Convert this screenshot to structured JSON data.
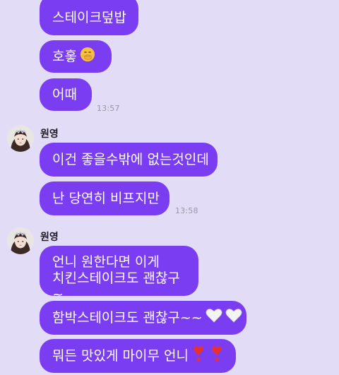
{
  "conversation": {
    "block1": {
      "messages": [
        {
          "text": "스테이크덮밥"
        },
        {
          "text": "호홓"
        },
        {
          "text": "어때"
        }
      ],
      "time": "13:57"
    },
    "block2": {
      "sender": "원영",
      "messages": [
        {
          "text": "이건 좋을수밖에 없는것인데"
        },
        {
          "text": "난 당연히 비프지만"
        }
      ],
      "time": "13:58"
    },
    "block3": {
      "sender": "원영",
      "messages": [
        {
          "line1": "언니 원한다면 이게",
          "line2": "치킨스테이크도 괜찮구~"
        },
        {
          "text": "함박스테이크도 괜찮구~~"
        },
        {
          "text": "뭐든 맛있게 마이무 언니"
        }
      ]
    }
  },
  "colors": {
    "background": "#e3dcf7",
    "bubble": "#7b3df2",
    "bubble_text": "#ffffff",
    "timestamp": "#9a95a8"
  },
  "icons": {
    "hoho_emoji": "face-with-hand-over-mouth-emoji",
    "hearts": "white-heart-emoji",
    "exclamation": "red-heart-exclamation-emoji",
    "avatar": "profile-photo-avatar"
  }
}
